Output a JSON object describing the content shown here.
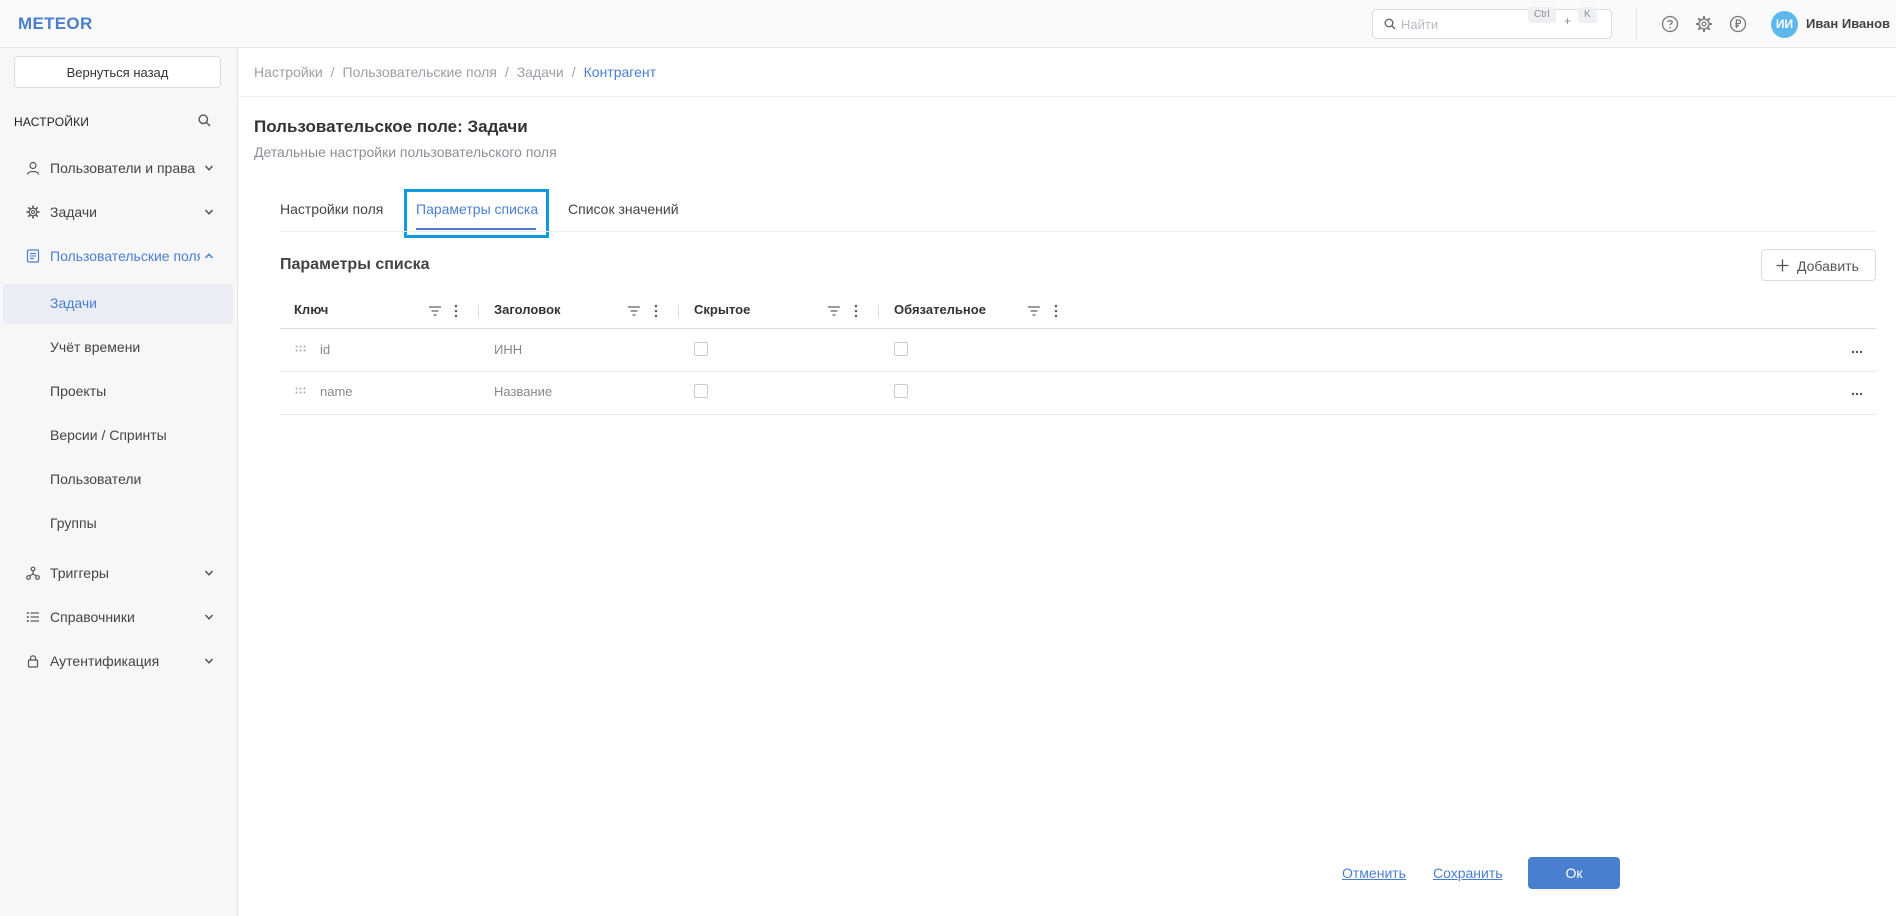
{
  "app": {
    "logo": "METEOR"
  },
  "header": {
    "search_placeholder": "Найти",
    "shortcut_ctrl": "Ctrl",
    "shortcut_plus": "+",
    "shortcut_key": "K",
    "user_initials": "ИИ",
    "user_name": "Иван Иванов",
    "icons": [
      "help-icon",
      "settings-icon",
      "currency-icon"
    ]
  },
  "sidebar": {
    "back_label": "Вернуться назад",
    "title": "НАСТРОЙКИ",
    "items": [
      {
        "label": "Пользователи и права",
        "icon": "user-icon",
        "expanded": false
      },
      {
        "label": "Задачи",
        "icon": "gear-icon",
        "expanded": false
      },
      {
        "label": "Пользовательские поля",
        "icon": "document-icon",
        "expanded": true,
        "active": true
      },
      {
        "label": "Триггеры",
        "icon": "network-icon",
        "expanded": false
      },
      {
        "label": "Справочники",
        "icon": "list-icon",
        "expanded": false
      },
      {
        "label": "Аутентификация",
        "icon": "lock-icon",
        "expanded": false
      }
    ],
    "sub_items": [
      {
        "label": "Задачи",
        "selected": true
      },
      {
        "label": "Учёт времени"
      },
      {
        "label": "Проекты"
      },
      {
        "label": "Версии / Спринты"
      },
      {
        "label": "Пользователи"
      },
      {
        "label": "Группы"
      }
    ]
  },
  "breadcrumb": [
    "Настройки",
    "Пользовательские поля",
    "Задачи",
    "Контрагент"
  ],
  "page": {
    "title": "Пользовательское поле: Задачи",
    "subtitle": "Детальные настройки пользовательского поля"
  },
  "tabs": [
    {
      "label": "Настройки поля"
    },
    {
      "label": "Параметры списка",
      "active": true
    },
    {
      "label": "Список значений"
    }
  ],
  "section": {
    "title": "Параметры списка",
    "add_label": "Добавить"
  },
  "table": {
    "columns": [
      "Ключ",
      "Заголовок",
      "Скрытое",
      "Обязательное"
    ],
    "rows": [
      {
        "key": "id",
        "title": "ИНН",
        "hidden": false,
        "required": false
      },
      {
        "key": "name",
        "title": "Название",
        "hidden": false,
        "required": false
      }
    ]
  },
  "footer": {
    "cancel_label": "Отменить",
    "save_label": "Сохранить",
    "ok_label": "Ок"
  },
  "colors": {
    "accent": "#4a7fd0",
    "avatar": "#5fb8ec",
    "focus_outline": "#1199dd"
  }
}
